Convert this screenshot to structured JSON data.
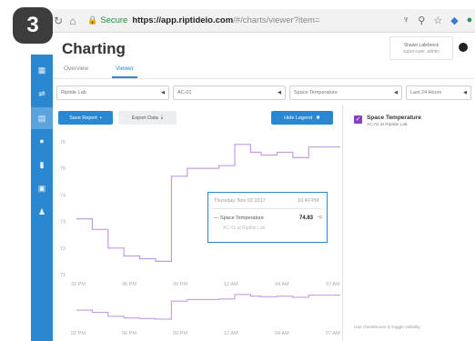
{
  "step_badge": "3",
  "browser": {
    "secure_label": "Secure",
    "url_host": "https://app.riptideio.com",
    "url_path": "/#/charts/viewer?item="
  },
  "app": {
    "title": "Charting",
    "user": {
      "name": "Shawn Lalebrock",
      "sub": "super-user, admin"
    },
    "tabs": [
      {
        "label": "Overview",
        "active": false
      },
      {
        "label": "Viewer",
        "active": true
      }
    ],
    "filters": {
      "site": "Riptide Lab",
      "device": "AC-01",
      "point": "Space Temperature",
      "range": "Last 24 Hours"
    },
    "toolbar": {
      "save_label": "Save Report",
      "export_label": "Export Data",
      "hide_legend_label": "Hide Legend"
    },
    "tooltip": {
      "date": "Thursday, Nov 02 2017",
      "time": "10:40 PM",
      "series": "Space Temperature",
      "value": "74.83",
      "unit": "°F",
      "sub": "AC-01 at Riptide Lab"
    },
    "legend": {
      "name": "Space Temperature",
      "sub": "AC-01 at Riptide Lab",
      "hint": "Use checkboxes to toggle visibility"
    }
  },
  "colors": {
    "accent": "#2a87d0",
    "series": "#c29ce6",
    "checkbox": "#8b3fc0",
    "secure": "#1a8f3c"
  },
  "chart_data": {
    "type": "line",
    "series": [
      {
        "name": "Space Temperature",
        "x": [
          0,
          0.06,
          0.12,
          0.18,
          0.24,
          0.3,
          0.36,
          0.42,
          0.48,
          0.54,
          0.6,
          0.66,
          0.7,
          0.76,
          0.82,
          0.88,
          0.94,
          1.0
        ],
        "values": [
          73.1,
          72.7,
          72.0,
          71.7,
          71.6,
          71.5,
          74.7,
          75.0,
          75.0,
          75.1,
          75.9,
          75.6,
          75.5,
          75.6,
          75.4,
          75.8,
          75.8,
          75.8
        ]
      }
    ],
    "x_ticks": [
      "02 PM",
      "06 PM",
      "09 PM",
      "12 AM",
      "04 AM",
      "07 AM"
    ],
    "y_ticks": [
      "76",
      "75",
      "74",
      "73",
      "72",
      "71"
    ],
    "ylim": [
      71,
      76.2
    ],
    "overview_x_ticks": [
      "02 PM",
      "06 PM",
      "09 PM",
      "12 AM",
      "04 AM",
      "07 AM"
    ]
  }
}
